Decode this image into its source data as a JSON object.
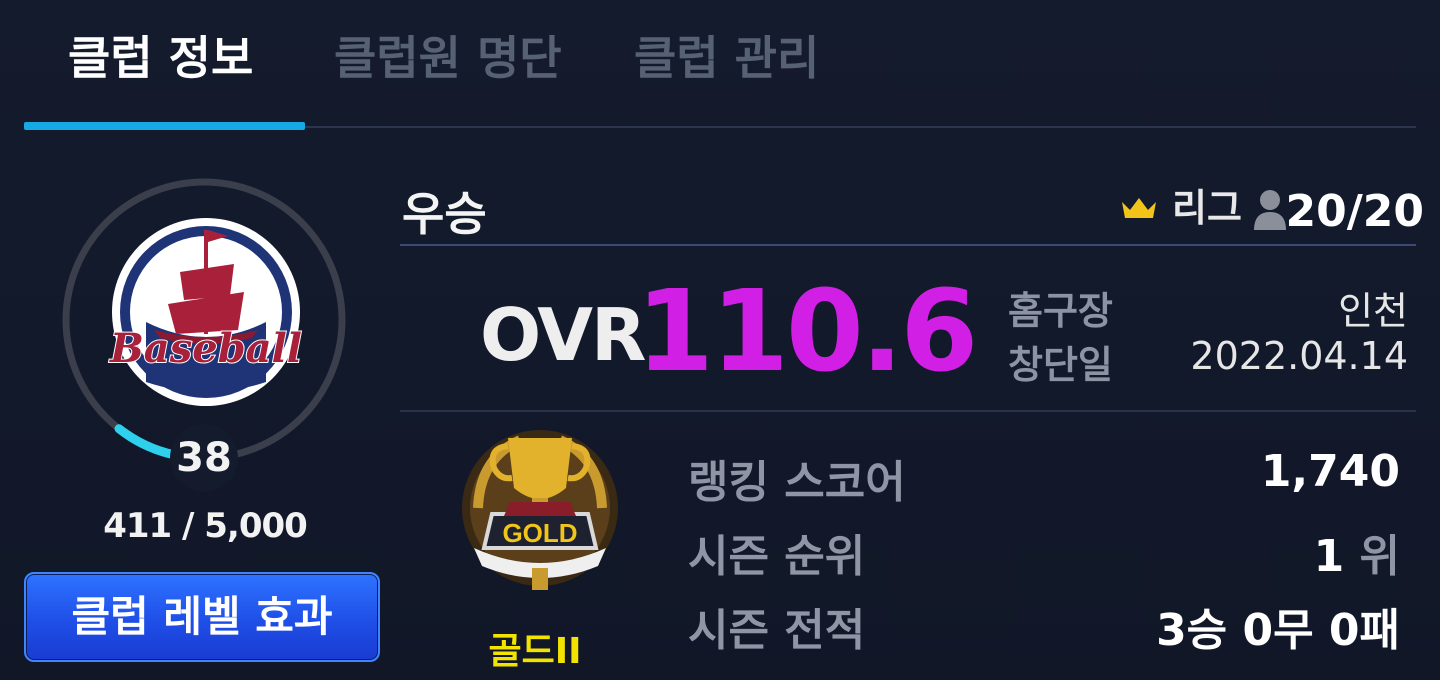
{
  "tabs": [
    {
      "label": "클럽 정보",
      "active": true
    },
    {
      "label": "클럽원 명단",
      "active": false
    },
    {
      "label": "클럽 관리",
      "active": false
    }
  ],
  "club": {
    "name": "우승",
    "emblem_text": "Baseball",
    "league_label": "리그",
    "member_count": "20/20",
    "level": "38",
    "exp": "411 / 5,000",
    "exp_progress": 0.082,
    "level_button": "클럽 레벨 효과"
  },
  "ovr": {
    "label": "OVR",
    "value": "110.6"
  },
  "info": [
    {
      "label": "홈구장",
      "value": "인천"
    },
    {
      "label": "창단일",
      "value": "2022.04.14"
    }
  ],
  "tier": {
    "label": "골드II",
    "badge_text": "GOLD"
  },
  "stats": [
    {
      "label": "랭킹 스코어",
      "value": "1,740",
      "unit": ""
    },
    {
      "label": "시즌 순위",
      "value": "1",
      "unit": "위"
    },
    {
      "label": "시즌 전적",
      "value": "3승 0무 0패",
      "unit": ""
    }
  ],
  "colors": {
    "background": "#131a2c",
    "tab_active_underline": "#17a9e6",
    "ovr_value": "#d21fe6",
    "tier_label": "#f2e400",
    "button": "#2458f0",
    "level_ring_progress": "#2fd0ee",
    "emblem_red": "#a8203a",
    "emblem_navy": "#1f3477"
  }
}
